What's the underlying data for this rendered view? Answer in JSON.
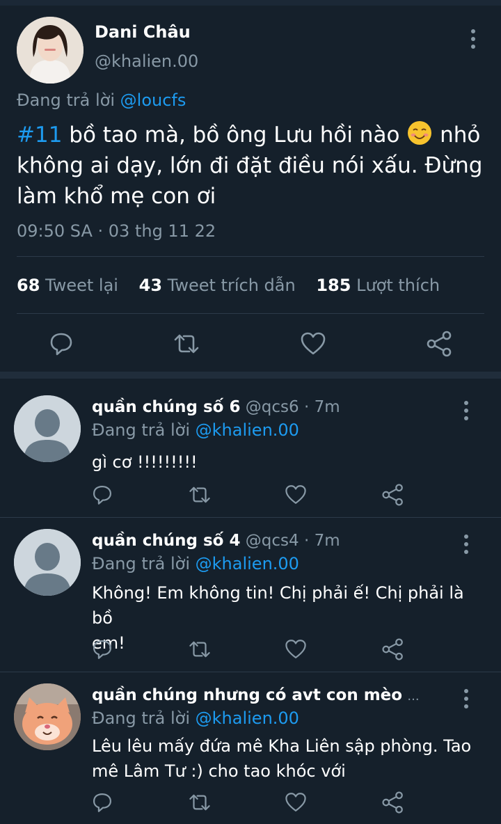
{
  "main_tweet": {
    "display_name": "Dani Châu",
    "handle": "@khalien.00",
    "reply_prefix": "Đang trả lời",
    "reply_to": "@loucfs",
    "hashtag": "#11",
    "text_line1": "bồ tao mà, bồ ông Lưu hồi nào",
    "emoji": "smiling-face-icon",
    "text_line1_end": "nhỏ",
    "text_line2": "không ai dạy, lớn đi đặt điều nói xấu. Đừng",
    "text_line3": "làm khổ mẹ con ơi",
    "timestamp": "09:50 SA · 03 thg 11 22",
    "stats": {
      "retweets_count": "68",
      "retweets_label": "Tweet lại",
      "quotes_count": "43",
      "quotes_label": "Tweet trích dẫn",
      "likes_count": "185",
      "likes_label": "Lượt thích"
    }
  },
  "replies": [
    {
      "name": "quần chúng số 6",
      "handle": "@qcs6",
      "time": "· 7m",
      "reply_prefix": "Đang trả lời",
      "reply_to": "@khalien.00",
      "text": "gì cơ !!!!!!!!!"
    },
    {
      "name": "quần chúng số 4",
      "handle": "@qcs4",
      "time": "· 7m",
      "reply_prefix": "Đang trả lời",
      "reply_to": "@khalien.00",
      "text_line1": "Không! Em không tin! Chị phải ế! Chị phải là bồ",
      "text_line2": "em!"
    },
    {
      "name": "quần chúng nhưng có avt con mèo",
      "ellipsis": "...",
      "reply_prefix": "Đang trả lời",
      "reply_to": "@khalien.00",
      "text_line1": "Lêu lêu mấy đứa mê Kha Liên sập phòng. Tao",
      "text_line2": "mê Lâm Tư :) cho tao khóc với"
    }
  ],
  "colors": {
    "background": "#15202b",
    "accent": "#1d9bf0",
    "secondary_text": "#8899a6",
    "divider": "#2c3a49"
  }
}
